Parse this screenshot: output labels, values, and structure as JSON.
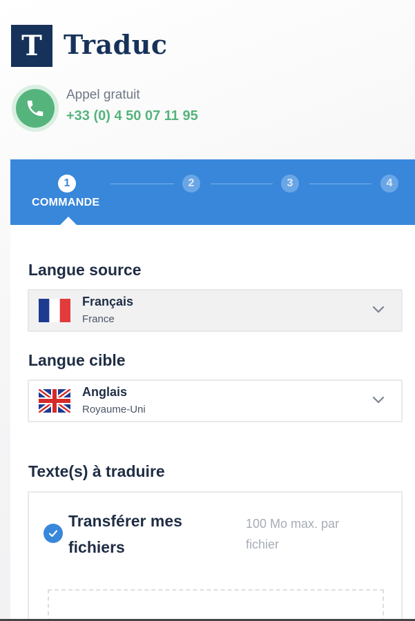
{
  "brand": {
    "logo_letter": "T",
    "name": "Traduc"
  },
  "contact": {
    "label": "Appel gratuit",
    "phone": "+33 (0) 4 50 07 11 95",
    "icon": "phone-icon"
  },
  "stepper": {
    "steps": [
      {
        "number": "1",
        "label": "COMMANDE",
        "active": true
      },
      {
        "number": "2",
        "active": false
      },
      {
        "number": "3",
        "active": false
      },
      {
        "number": "4",
        "active": false
      }
    ],
    "accent": "#3887da"
  },
  "source_language": {
    "title": "Langue source",
    "selected": {
      "name": "Français",
      "country": "France",
      "flag": "france-flag-icon"
    }
  },
  "target_language": {
    "title": "Langue cible",
    "selected": {
      "name": "Anglais",
      "country": "Royaume-Uni",
      "flag": "uk-flag-icon"
    }
  },
  "texts": {
    "title": "Texte(s) à traduire",
    "upload_option": {
      "label": "Transférer mes fichiers",
      "hint": "100 Mo max. par fichier",
      "checked": true
    }
  },
  "colors": {
    "brand": "#17325a",
    "phone_green": "#55b47c",
    "blue": "#3887da"
  }
}
